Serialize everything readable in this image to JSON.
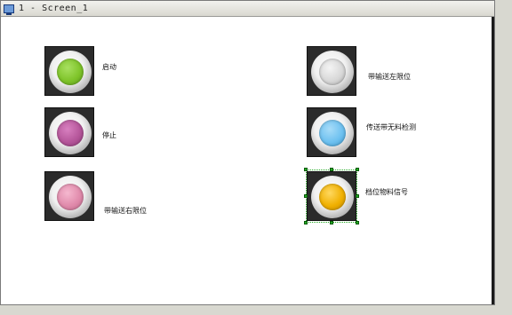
{
  "window": {
    "title": "1 - Screen_1"
  },
  "indicators": [
    {
      "id": "start",
      "label": "启动",
      "color": "#7fc42a"
    },
    {
      "id": "stop",
      "label": "停止",
      "color": "#b5569a"
    },
    {
      "id": "belt-right-limit",
      "label": "带输送右限位",
      "color": "#e08aab"
    },
    {
      "id": "belt-left-limit",
      "label": "带输送左限位",
      "color": "#d8d8d8"
    },
    {
      "id": "belt-no-material",
      "label": "传送带无料检测",
      "color": "#6ec1f0"
    },
    {
      "id": "positioning-signal",
      "label": "档位物料信号",
      "color": "#f0b000"
    }
  ],
  "selection_color": "#22aa22"
}
